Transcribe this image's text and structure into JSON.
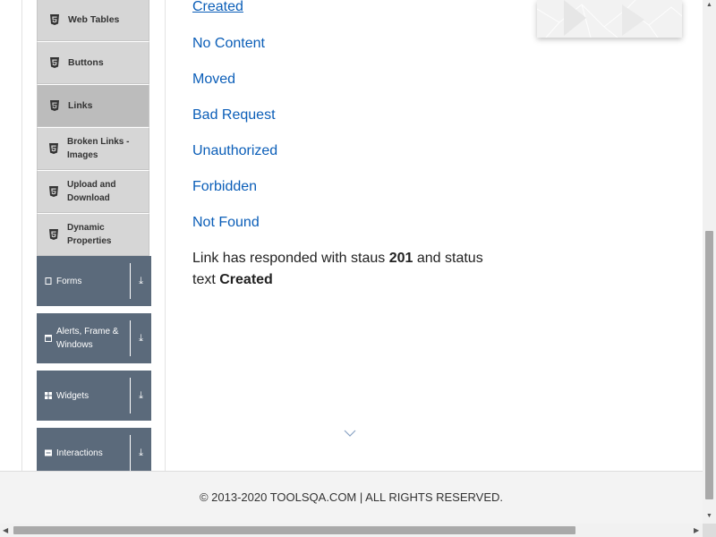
{
  "sidebar": {
    "sub_items": [
      {
        "label": "Web Tables",
        "icon": "html5-icon",
        "active": false
      },
      {
        "label": "Buttons",
        "icon": "html5-icon",
        "active": false
      },
      {
        "label": "Links",
        "icon": "html5-icon",
        "active": true
      },
      {
        "label": "Broken Links - Images",
        "icon": "html5-icon",
        "active": false
      },
      {
        "label": "Upload and Download",
        "icon": "html5-icon",
        "active": false
      },
      {
        "label": "Dynamic Properties",
        "icon": "html5-icon",
        "active": false
      }
    ],
    "groups": [
      {
        "label": "Forms",
        "icon": "file-icon",
        "arrow_icon": "download-arrow-icon"
      },
      {
        "label": "Alerts, Frame & Windows",
        "icon": "window-icon",
        "arrow_icon": "download-arrow-icon"
      },
      {
        "label": "Widgets",
        "icon": "grid-icon",
        "arrow_icon": "download-arrow-icon"
      },
      {
        "label": "Interactions",
        "icon": "list-icon",
        "arrow_icon": "download-arrow-icon"
      }
    ],
    "arrow_glyph": "⤓"
  },
  "main": {
    "links": [
      {
        "label": "Created"
      },
      {
        "label": "No Content"
      },
      {
        "label": "Moved"
      },
      {
        "label": "Bad Request"
      },
      {
        "label": "Unauthorized"
      },
      {
        "label": "Forbidden"
      },
      {
        "label": "Not Found"
      }
    ],
    "response": {
      "prefix": "Link has responded with staus",
      "status_code": "201",
      "middle": "and status text",
      "status_text": "Created"
    }
  },
  "footer": {
    "text": "© 2013-2020 TOOLSQA.COM | ALL RIGHTS RESERVED."
  },
  "colors": {
    "link": "#0b5eb8",
    "group_bg": "#5b6a7b",
    "sub_item_bg": "#d6d6d6",
    "active_sub_item_bg": "#bcbcbc",
    "footer_bg": "#f3f3f3"
  },
  "scrollbars": {
    "up_arrow": "▲",
    "down_arrow": "▼",
    "left_arrow": "◀",
    "right_arrow": "▶"
  }
}
